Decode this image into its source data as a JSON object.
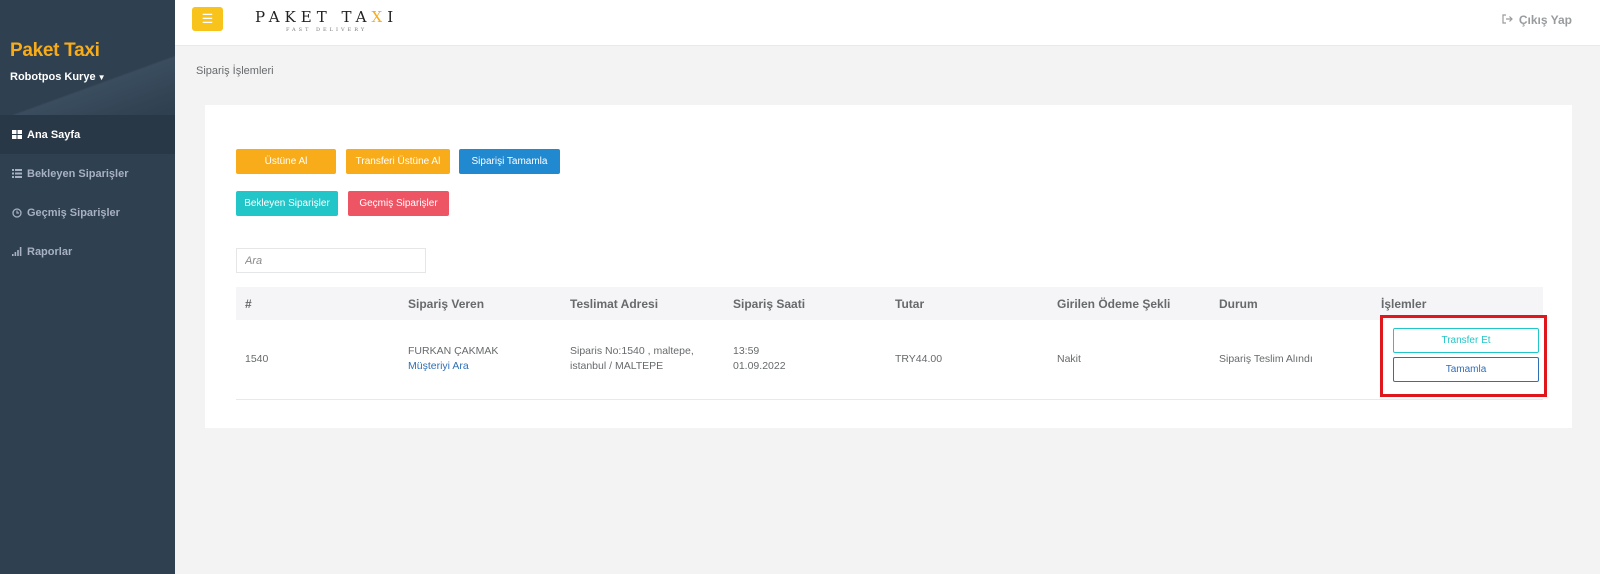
{
  "sidebar": {
    "brand": "Paket Taxi",
    "user": "Robotpos Kurye",
    "items": [
      {
        "label": "Ana Sayfa",
        "icon": "grid-icon",
        "active": true
      },
      {
        "label": "Bekleyen Siparişler",
        "icon": "list-icon"
      },
      {
        "label": "Geçmiş Siparişler",
        "icon": "clock-icon"
      },
      {
        "label": "Raporlar",
        "icon": "bar-chart-icon"
      }
    ]
  },
  "topbar": {
    "logo_main_prefix": "PAKET TA",
    "logo_main_x": "X",
    "logo_main_suffix": "I",
    "logo_sub": "FAST DELIVERY",
    "logout": "Çıkış Yap"
  },
  "breadcrumb": "Sipariş İşlemleri",
  "buttons": {
    "ustune_al": "Üstüne Al",
    "transferi_ustune_al": "Transferi Üstüne Al",
    "siparisi_tamamla": "Siparişi Tamamla",
    "bekleyen": "Bekleyen Siparişler",
    "gecmis": "Geçmiş Siparişler"
  },
  "search": {
    "placeholder": "Ara"
  },
  "table": {
    "headers": [
      "#",
      "Sipariş Veren",
      "Teslimat Adresi",
      "Sipariş Saati",
      "Tutar",
      "Girilen Ödeme Şekli",
      "Durum",
      "İşlemler"
    ],
    "rows": [
      {
        "id": "1540",
        "customer": "FURKAN ÇAKMAK",
        "customer_link": "Müşteriyi Ara",
        "address_line1": "Siparis No:1540 , maltepe,",
        "address_line2": "istanbul / MALTEPE",
        "time": "13:59",
        "date": "01.09.2022",
        "amount": "TRY44.00",
        "payment": "Nakit",
        "status": "Sipariş Teslim Alındı",
        "action_transfer": "Transfer Et",
        "action_complete": "Tamamla"
      }
    ]
  },
  "colors": {
    "sidebar_bg": "#2f4050",
    "brand": "#f8ac1a",
    "primary": "#2189d0",
    "info": "#23c6c8",
    "danger": "#ed5565",
    "highlight": "#e0161d"
  }
}
